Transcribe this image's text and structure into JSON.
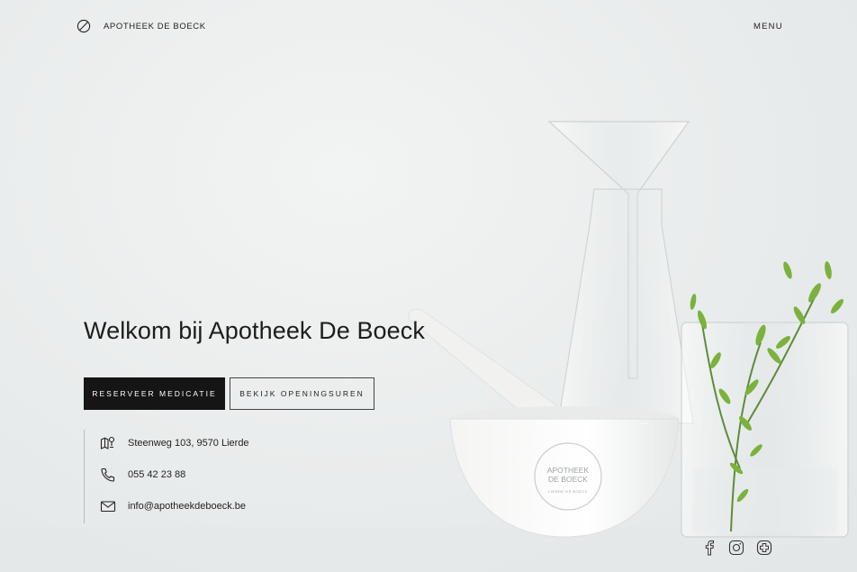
{
  "header": {
    "logo_text": "APOTHEEK DE BOECK",
    "menu_label": "MENU"
  },
  "hero": {
    "title": "Welkom bij Apotheek De Boeck",
    "primary_button": "RESERVEER MEDICATIE",
    "secondary_button": "BEKIJK OPENINGSUREN"
  },
  "contact": {
    "address": "Steenweg 103, 9570 Lierde",
    "phone": "055 42 23 88",
    "email": "info@apotheekdeboeck.be"
  },
  "mortar_stamp": {
    "line1": "APOTHEEK",
    "line2": "DE BOECK",
    "line3": "LIERDE DE BOECK"
  },
  "icons": {
    "logo": "no-entry-circle-icon",
    "address": "map-pin-icon",
    "phone": "phone-icon",
    "email": "envelope-icon",
    "facebook": "facebook-icon",
    "instagram": "instagram-icon",
    "plus": "pharmacy-cross-icon"
  }
}
